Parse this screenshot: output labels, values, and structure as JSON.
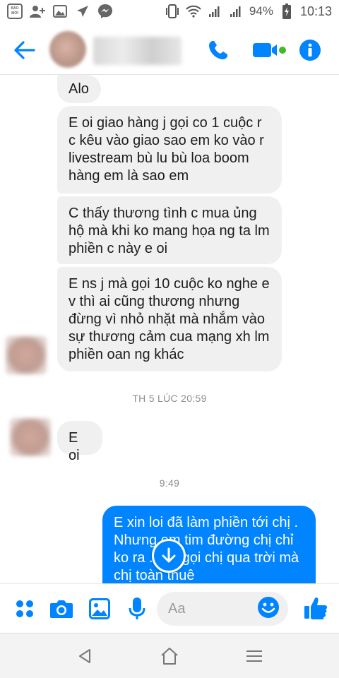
{
  "status_bar": {
    "battery": "94%",
    "time": "10:13",
    "app_icon_text": "BÁO MỚI"
  },
  "header": {
    "back_icon": "arrow-left-icon",
    "call_icon": "phone-icon",
    "video_icon": "video-camera-icon",
    "info_icon": "info-icon",
    "accent_color": "#0084ff"
  },
  "messages": [
    {
      "sender": "contact",
      "text": "Alo"
    },
    {
      "sender": "contact",
      "text": "E oi giao hàng j gọi co 1 cuộc r c kêu vào giao sao em ko vào r livestream bù lu bù loa boom hàng em là sao em"
    },
    {
      "sender": "contact",
      "text": "C thấy thương tình c mua ủng hộ mà khi ko mang họa ng ta lm phiền c này e oi"
    },
    {
      "sender": "contact",
      "text": "E ns j mà gọi 10 cuộc ko nghe e v thì ai cũng thương nhưng đừng vì nhỏ nhặt mà nhắm vào sự thương cảm cua mạng xh lm phiền oan ng khác"
    },
    {
      "sender": "contact",
      "text": "E oi"
    },
    {
      "sender": "me",
      "text": "E xin loi đã làm phiền tới chị . Nhưng em tim đường chị chỉ ko ra . Em gọi chị qua trời mà chị toàn thuê"
    }
  ],
  "timestamps": {
    "first": "TH 5 LÚC 20:59",
    "second": "9:49"
  },
  "composer": {
    "placeholder": "Aa",
    "icons": [
      "apps-icon",
      "camera-icon",
      "image-icon",
      "microphone-icon",
      "emoji-icon",
      "thumbs-up-icon"
    ]
  },
  "nav": {
    "icons": [
      "back-triangle-icon",
      "home-icon",
      "menu-icon"
    ]
  }
}
